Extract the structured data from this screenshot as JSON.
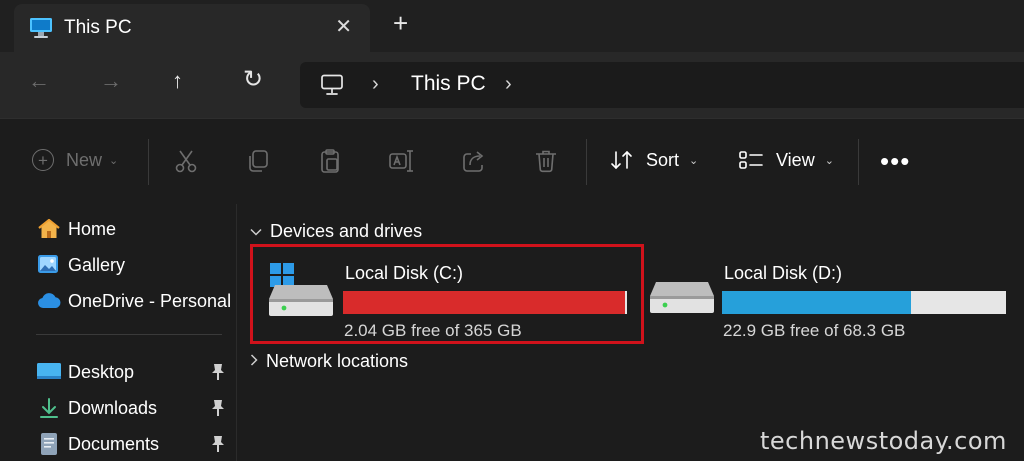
{
  "tab": {
    "title": "This PC",
    "close_glyph": "✕",
    "new_tab_glyph": "+",
    "icon": "pc-icon"
  },
  "nav": {
    "back_glyph": "←",
    "forward_glyph": "→",
    "up_glyph": "↑",
    "refresh_glyph": "↻",
    "address_icon": "monitor-icon",
    "separator_glyph": "›",
    "breadcrumb": "This PC"
  },
  "toolbar": {
    "new_label": "New",
    "new_glyph": "+",
    "sort_label": "Sort",
    "view_label": "View",
    "chevron_glyph": "⌄",
    "more_glyph": "•••",
    "icons": [
      "cut-icon",
      "copy-icon",
      "paste-icon",
      "rename-icon",
      "share-icon",
      "delete-icon",
      "sort-icon",
      "view-icon"
    ]
  },
  "sidebar": {
    "items": [
      {
        "label": "Home",
        "icon": "home-icon",
        "pinned": false
      },
      {
        "label": "Gallery",
        "icon": "gallery-icon",
        "pinned": false
      },
      {
        "label": "OneDrive - Personal",
        "icon": "cloud-icon",
        "pinned": false
      },
      {
        "label": "Desktop",
        "icon": "desktop-icon",
        "pinned": true
      },
      {
        "label": "Downloads",
        "icon": "downloads-icon",
        "pinned": true
      },
      {
        "label": "Documents",
        "icon": "documents-icon",
        "pinned": true
      }
    ]
  },
  "main": {
    "devices_header": "Devices and drives",
    "network_header": "Network locations",
    "drives": [
      {
        "name": "Local Disk (C:)",
        "free_text": "2.04 GB free of 365 GB",
        "used_fraction": 0.9944,
        "bar_color": "#d92b2b",
        "highlighted": true,
        "system_drive": true
      },
      {
        "name": "Local Disk (D:)",
        "free_text": "22.9 GB free of 68.3 GB",
        "used_fraction": 0.6647,
        "bar_color": "#26a0da",
        "highlighted": false,
        "system_drive": false
      }
    ]
  },
  "colors": {
    "highlight_border": "#d0121b",
    "accent_blue": "#26a0da",
    "low_space_red": "#d92b2b"
  },
  "watermark": "technewstoday.com"
}
